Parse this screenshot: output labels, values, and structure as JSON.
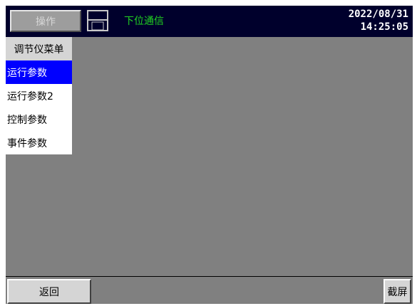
{
  "header": {
    "operate_label": "操作",
    "comm_status": "下位通信",
    "date": "2022/08/31",
    "time": "14:25:05",
    "save_icon": "floppy-disk-icon"
  },
  "menu": {
    "title": "调节仪菜单",
    "items": [
      {
        "label": "运行参数",
        "selected": true
      },
      {
        "label": "运行参数2",
        "selected": false
      },
      {
        "label": "控制参数",
        "selected": false
      },
      {
        "label": "事件参数",
        "selected": false
      }
    ]
  },
  "footer": {
    "back_label": "返回",
    "screenshot_label": "截屏"
  },
  "colors": {
    "background": "#808080",
    "topbar": "#00002c",
    "comm_status": "#21d421",
    "selected": "#0000ff"
  }
}
